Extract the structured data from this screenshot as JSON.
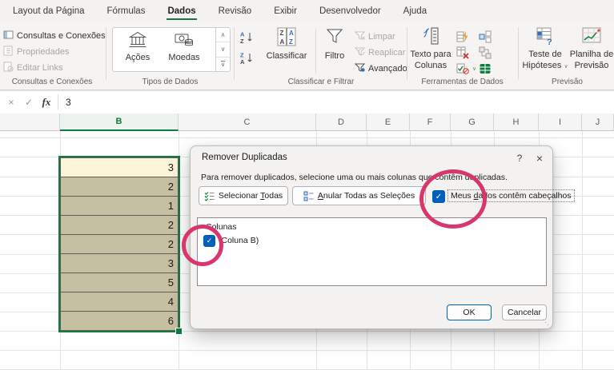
{
  "menu": {
    "tabs": [
      "Layout da Página",
      "Fórmulas",
      "Dados",
      "Revisão",
      "Exibir",
      "Desenvolvedor",
      "Ajuda"
    ],
    "active_tab": "Dados"
  },
  "ribbon": {
    "queries_group": {
      "label": "Consultas e Conexões",
      "item1": "Consultas e Conexões",
      "item2": "Propriedades",
      "item3": "Editar Links"
    },
    "datatypes_group": {
      "label": "Tipos de Dados",
      "item1": "Ações",
      "item2": "Moedas"
    },
    "sort_group": {
      "label": "Classificar e Filtrar",
      "az_a": "A",
      "az_z": "Z",
      "sort_button": "Classificar",
      "filter_button": "Filtro",
      "clear": "Limpar",
      "reapply": "Reaplicar",
      "advanced": "Avançado"
    },
    "tools_group": {
      "label": "Ferramentas de Dados",
      "text_to_columns_l1": "Texto para",
      "text_to_columns_l2": "Colunas"
    },
    "forecast_group": {
      "label": "Previsão",
      "whatif_l1": "Teste de",
      "whatif_l2": "Hipóteses",
      "sheet_l1": "Planilha de",
      "sheet_l2": "Previsão"
    }
  },
  "icons": {
    "check_glyph": "✓",
    "chevron_up": "∧",
    "chevron_down": "∨",
    "grip_glyph": "⋱"
  },
  "formula_bar": {
    "value": "3",
    "fx_label": "fx",
    "cancel_glyph": "×",
    "enter_glyph": "✓"
  },
  "sheet": {
    "columns": [
      "",
      "B",
      "C",
      "D",
      "E",
      "F",
      "G",
      "H",
      "I",
      "J"
    ],
    "cells": [
      "3",
      "2",
      "1",
      "2",
      "2",
      "3",
      "5",
      "4",
      "6"
    ]
  },
  "dialog": {
    "title": "Remover Duplicadas",
    "help_glyph": "?",
    "close_glyph": "×",
    "description": "Para remover duplicados, selecione uma ou mais colunas que contêm duplicadas.",
    "select_all": {
      "pre": "Selecionar ",
      "key": "T",
      "post": "odas"
    },
    "unselect_all": {
      "pre": "",
      "key": "A",
      "post": "nular Todas as Seleções"
    },
    "headers_checkbox": {
      "pre": "Meus ",
      "key": "d",
      "post": "ados contêm cabeçalhos"
    },
    "columns_header": "Colunas",
    "column_item": "(Coluna B)",
    "ok": "OK",
    "cancel": "Cancelar"
  },
  "colors": {
    "accent_green": "#107C41",
    "checkbox_blue": "#005FB8",
    "annotation_pink": "#D9366B",
    "selection_fill": "#C6C0A3",
    "active_cell_fill": "#FCF3D8"
  }
}
